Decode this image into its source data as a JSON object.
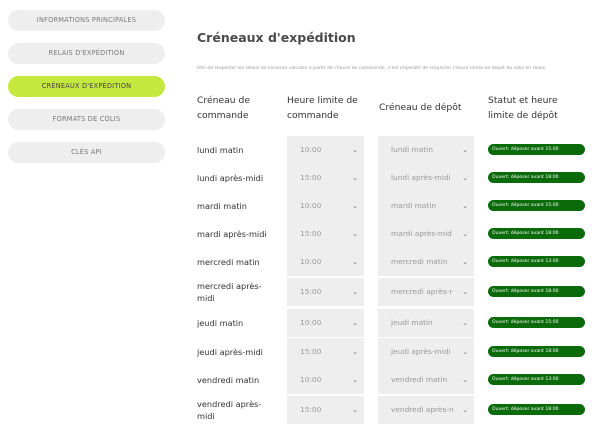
{
  "sidebar": {
    "items": [
      {
        "label": "INFORMATIONS PRINCIPALES",
        "active": false
      },
      {
        "label": "RELAIS D'EXPÉDITION",
        "active": false
      },
      {
        "label": "CRÉNEAUX D'EXPÉDITION",
        "active": true
      },
      {
        "label": "FORMATS DE COLIS",
        "active": false
      },
      {
        "label": "CLÉS API",
        "active": false
      }
    ]
  },
  "main": {
    "title": "Créneaux d'expédition",
    "intro": "Afin de respecter les délais de livraison calculés à partir de l'heure de commande, il est impératif de respecter l'heure limite de dépôt du colis en relais.",
    "headers": {
      "slot": [
        "Créneau de",
        "commande"
      ],
      "deadline": [
        "Heure limite de",
        "commande"
      ],
      "depot": [
        "Créneau de dépôt"
      ],
      "status": [
        "Statut et heure",
        "limite de dépôt"
      ]
    },
    "rows": [
      {
        "day": [
          "lundi matin"
        ],
        "time": "10:00",
        "depot": "lundi matin",
        "status": "Ouvert: déposer avant 15:00"
      },
      {
        "day": [
          "lundi après-midi"
        ],
        "time": "15:00",
        "depot": "lundi après-midi",
        "status": "Ouvert: déposer avant 18:00"
      },
      {
        "day": [
          "mardi matin"
        ],
        "time": "10:00",
        "depot": "mardi matin",
        "status": "Ouvert: déposer avant 15:00"
      },
      {
        "day": [
          "mardi après-midi"
        ],
        "time": "15:00",
        "depot": "mardi après-mid",
        "status": "Ouvert: déposer avant 18:00"
      },
      {
        "day": [
          "mercredi matin"
        ],
        "time": "10:00",
        "depot": "mercredi matin",
        "status": "Ouvert: déposer avant 13:00"
      },
      {
        "day": [
          "mercredi après-",
          "midi"
        ],
        "time": "15:00",
        "depot": "mercredi après-r",
        "status": "Ouvert: déposer avant 18:00"
      },
      {
        "day": [
          "jeudi matin"
        ],
        "time": "10:00",
        "depot": "jeudi matin",
        "status": "Ouvert: déposer avant 15:00"
      },
      {
        "day": [
          "jeudi après-midi"
        ],
        "time": "15:00",
        "depot": "jeudi après-midi",
        "status": "Ouvert: déposer avant 18:00"
      },
      {
        "day": [
          "vendredi matin"
        ],
        "time": "10:00",
        "depot": "vendredi matin",
        "status": "Ouvert: déposer avant 13:00"
      },
      {
        "day": [
          "vendredi après-",
          "midi"
        ],
        "time": "15:00",
        "depot": "vendredi après-n",
        "status": "Ouvert: déposer avant 18:00"
      }
    ]
  },
  "icons": {
    "select_chevron": "chevron-down-icon"
  },
  "colors": {
    "accent": "#c5e83e",
    "status_open": "#0b6b0b",
    "control_bg": "#eeeeee"
  }
}
